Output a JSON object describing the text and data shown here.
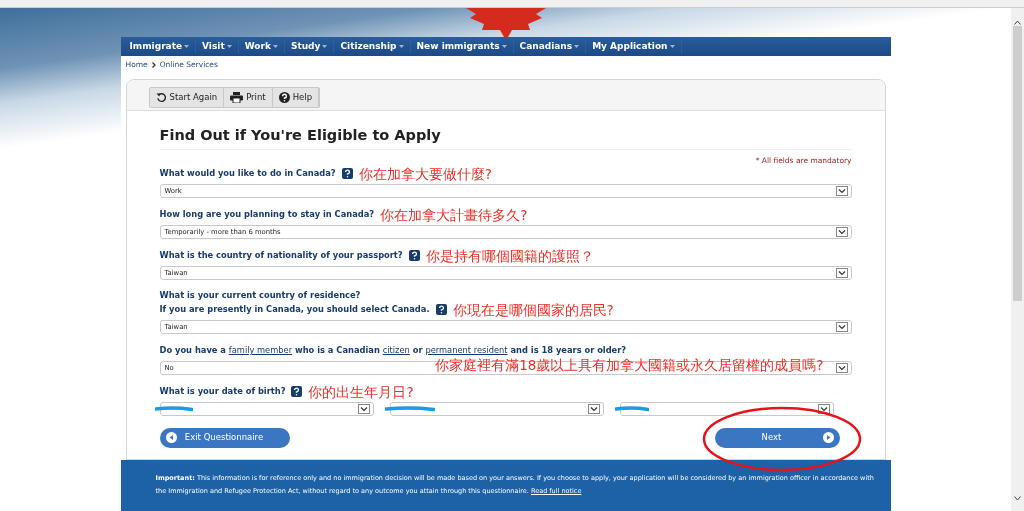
{
  "nav": [
    {
      "label": "Immigrate"
    },
    {
      "label": "Visit"
    },
    {
      "label": "Work"
    },
    {
      "label": "Study"
    },
    {
      "label": "Citizenship"
    },
    {
      "label": "New immigrants"
    },
    {
      "label": "Canadians"
    },
    {
      "label": "My Application"
    }
  ],
  "breadcrumb": [
    "Home",
    "Online Services"
  ],
  "toolbar": [
    {
      "label": "Start Again"
    },
    {
      "label": "Print"
    },
    {
      "label": "Help"
    }
  ],
  "title": "Find Out if You're Eligible to Apply",
  "mandatory_note": "* All fields are mandatory",
  "questions": [
    {
      "kind": "select",
      "label": [
        {
          "text": "What would you like to do in Canada?"
        }
      ],
      "help": true,
      "value": "Work",
      "annotation": "你在加拿大要做什麼?",
      "annotation_over_field": false
    },
    {
      "kind": "select",
      "label": [
        {
          "text": "How long are you planning to stay in Canada?"
        }
      ],
      "help": false,
      "value": "Temporarily - more than 6 months",
      "annotation": "你在加拿大計畫待多久?",
      "annotation_over_field": false
    },
    {
      "kind": "select",
      "label": [
        {
          "text": "What is the country of nationality of your passport?"
        }
      ],
      "help": true,
      "value": "Taiwan",
      "annotation": "你是持有哪個國籍的護照？",
      "annotation_over_field": false
    },
    {
      "kind": "select",
      "pre_line": "What is your current country of residence?",
      "label": [
        {
          "text": "If you are presently in Canada, you should select Canada."
        }
      ],
      "help": true,
      "value": "Taiwan",
      "annotation": "你現在是哪個國家的居民?",
      "annotation_over_field": false
    },
    {
      "kind": "select",
      "label": [
        {
          "text": "Do you have a "
        },
        {
          "text": "family member",
          "link": true
        },
        {
          "text": " who is a Canadian "
        },
        {
          "text": "citizen",
          "link": true
        },
        {
          "text": " or "
        },
        {
          "text": "permanent resident",
          "link": true
        },
        {
          "text": " and is 18 years or older?"
        }
      ],
      "help": false,
      "value": "No",
      "annotation": "你家庭裡有滿18歲以上具有加拿大國籍或永久居留權的成員嗎?",
      "annotation_over_field": true
    },
    {
      "kind": "date",
      "label": [
        {
          "text": "What is your date of birth?"
        }
      ],
      "help": true,
      "annotation": "你的出生年月日?",
      "annotation_over_field": false,
      "redacted": true
    }
  ],
  "buttons": [
    {
      "label": "Exit Questionnaire",
      "kind": "back"
    },
    {
      "label": "Next",
      "kind": "next",
      "circled": true
    }
  ],
  "footer": {
    "text": "**Important:** This information is for reference only and no immigration decision will be made based on your answers. If you choose to apply, your application will be considered by an immigration officer in accordance with the Immigration and Refugee Protection Act, without regard to any outcome you attain through this questionnaire.",
    "link": "Read full notice"
  }
}
